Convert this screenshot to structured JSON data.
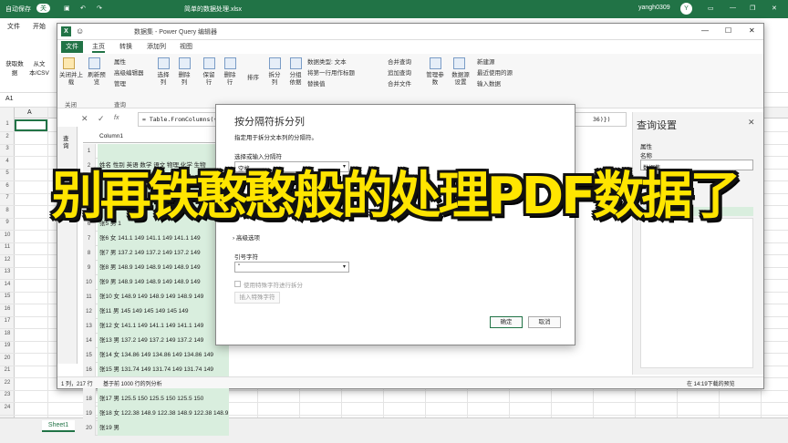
{
  "excel": {
    "autosave_label": "自动保存",
    "autosave_state": "关",
    "filename": "简单的数据处理.xlsx",
    "user": "yangh0309",
    "user_initial": "Y",
    "menu": [
      "文件",
      "开始"
    ],
    "ribbon_left": [
      "获取数据",
      "从文本/CSV"
    ],
    "namebox": "A1",
    "col_a": "A",
    "rows": [
      "1",
      "2",
      "3",
      "4",
      "5",
      "6",
      "7",
      "8",
      "9",
      "10",
      "11",
      "12",
      "13",
      "14",
      "15",
      "16",
      "17",
      "18",
      "19",
      "20",
      "21",
      "22",
      "23",
      "24"
    ],
    "sheet_tab": "Sheet1",
    "add_sheet": "+"
  },
  "pq": {
    "title": "数据集 - Power Query 编辑器",
    "tabs": [
      "文件",
      "主页",
      "转换",
      "添加列",
      "视图"
    ],
    "ribbon": {
      "close_upload": "关闭并上载",
      "refresh_preview": "刷新预览",
      "properties": "属性",
      "advanced_editor": "高级编辑器",
      "manage": "管理",
      "choose_cols": "选择列",
      "remove_cols": "删除列",
      "keep_rows": "保留行",
      "remove_rows": "删除行",
      "sort": "排序",
      "split_col": "拆分列",
      "group_by": "分组依据",
      "data_type": "数据类型: 文本",
      "first_row_header": "将第一行用作标题",
      "replace_values": "替换值",
      "merge_queries": "合并查询",
      "append_queries": "追加查询",
      "combine_files": "合并文件",
      "manage_params": "管理参数",
      "data_source_settings": "数据源设置",
      "new_source": "新建源",
      "recent_sources": "最近使用的源",
      "enter_data": "输入数据",
      "group_close": "关闭",
      "group_query": "查询"
    },
    "formula_prefix": "fx",
    "formula": "= Table.FromColumns({L",
    "formula_tail": "36)})",
    "nav_label": "查询",
    "column_header": "Column1",
    "table_rows": [
      {
        "n": "1",
        "v": ""
      },
      {
        "n": "2",
        "v": "姓名 性别 英语 数学 语文 物理 化学 生物"
      },
      {
        "n": "3",
        "v": ""
      },
      {
        "n": "4",
        "v": ""
      },
      {
        "n": "5",
        "v": ""
      },
      {
        "n": "6",
        "v": "张5 男 1"
      },
      {
        "n": "7",
        "v": "张6 女 141.1 149 141.1 149 141.1 149"
      },
      {
        "n": "8",
        "v": "张7 男 137.2 149 137.2 149 137.2 149"
      },
      {
        "n": "9",
        "v": "张8 男 148.9 149 148.9 149 148.9 149"
      },
      {
        "n": "10",
        "v": "张9 男 148.9 149 148.9 149 148.9 149"
      },
      {
        "n": "11",
        "v": "张10 女 148.9 149 148.9 149 148.9 149"
      },
      {
        "n": "12",
        "v": "张11 男 145 149 145 149 145 149"
      },
      {
        "n": "13",
        "v": "张12 女 141.1 149 141.1 149 141.1 149"
      },
      {
        "n": "14",
        "v": "张13 男 137.2 149 137.2 149 137.2 149"
      },
      {
        "n": "15",
        "v": "张14 女 134.86 149 134.86 149 134.86 149"
      },
      {
        "n": "16",
        "v": "张15 男 131.74 149 131.74 149 131.74 149"
      },
      {
        "n": "17",
        "v": "张16 女 128.62 149 128.62 149 128.62 149"
      },
      {
        "n": "18",
        "v": "张17 男 125.5 150 125.5 150 125.5 150"
      },
      {
        "n": "19",
        "v": "张18 女 122.38 148.9 122.38 148.9 122.38 148.9"
      },
      {
        "n": "20",
        "v": "张19 男"
      }
    ],
    "settings_title": "查询设置",
    "settings_props": "属性",
    "settings_name_label": "名称",
    "settings_name_value": "数据集",
    "status_left": "1 列，217 行",
    "status_mid": "基于前 1000 行的列分析",
    "status_right": "在 14:19下载的预览"
  },
  "dialog": {
    "title": "按分隔符拆分列",
    "subtitle": "指定用于拆分文本列的分隔符。",
    "select_label": "选择或输入分隔符",
    "select_value": "空格",
    "advanced": "高级选项",
    "quote_label": "引号字符",
    "quote_value": "\"",
    "special_chars": "使用特殊字符进行拆分",
    "insert_special": "插入特殊字符",
    "ok": "确定",
    "cancel": "取消"
  },
  "headline": "别再铁憨憨般的处理PDF数据了"
}
